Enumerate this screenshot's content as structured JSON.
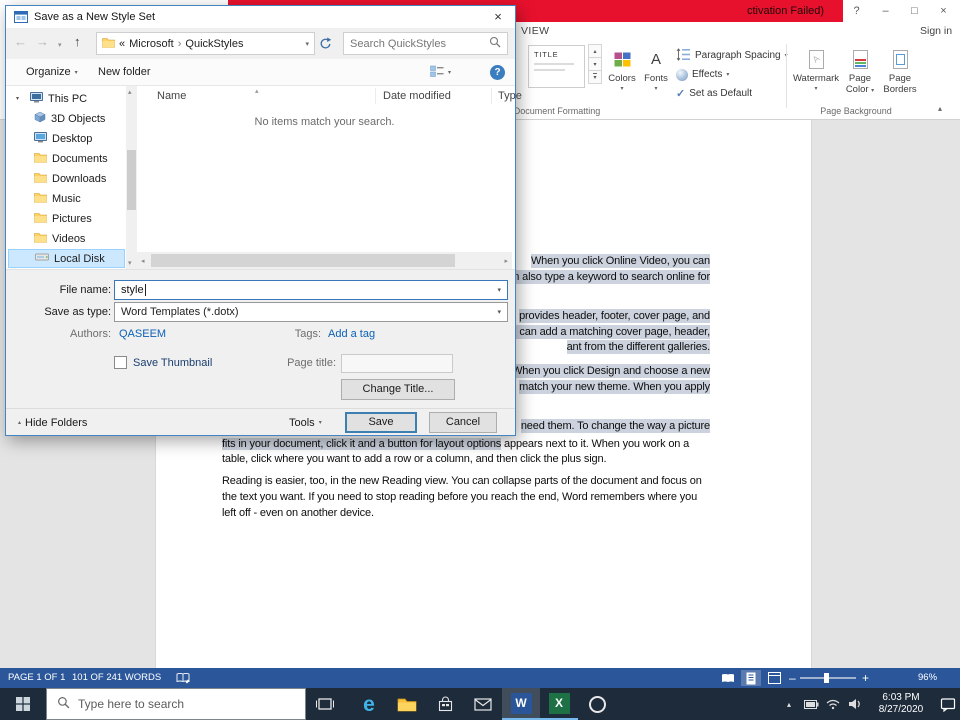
{
  "window": {
    "title_fragment": "ctivation Failed)",
    "active_tab": "VIEW",
    "sign_in": "Sign in",
    "controls": {
      "help": "?",
      "minimize": "–",
      "maximize": "□",
      "close": "×"
    }
  },
  "ribbon": {
    "style_gallery_item": "TITLE",
    "colors_label": "Colors",
    "fonts_label": "Fonts",
    "paragraph_spacing_label": "Paragraph Spacing",
    "effects_label": "Effects",
    "set_as_default_label": "Set as Default",
    "watermark_label": "Watermark",
    "page_color_label": "Page Color",
    "page_borders_label": "Page Borders",
    "group_document_formatting": "Document Formatting",
    "group_page_background": "Page Background"
  },
  "document": {
    "selection_fragments": [
      "When you click Online Video, you can",
      "an also type a keyword to search online for",
      "provides header, footer, cover page, and",
      "ou can add a matching cover page, header,",
      "ant from the different galleries.",
      "d. When you click Design and choose a new",
      "match your new theme. When you apply",
      "need them. To change the way a picture"
    ],
    "partial_line": {
      "selected": "fits in your document, click it and a button for layout options",
      "rest": " appears next to it. When you work on a"
    },
    "lines": [
      "table, click where you want to add a row or a column, and then click the plus sign.",
      "Reading is easier, too, in the new Reading view. You can collapse parts of the document and focus on",
      "the text you want. If you need to stop reading before you reach the end, Word remembers where you",
      "left off - even on another device."
    ]
  },
  "status_bar": {
    "page_info": "PAGE 1 OF 1",
    "word_count": "101 OF 241 WORDS",
    "zoom_level": "96%"
  },
  "dialog": {
    "title": "Save as a New Style Set",
    "nav": {
      "breadcrumb_overflow": "«",
      "crumb_parent": "Microsoft",
      "breadcrumb_separator": "›",
      "crumb_current": "QuickStyles",
      "search_placeholder": "Search QuickStyles"
    },
    "toolbar": {
      "organize_label": "Organize",
      "new_folder_label": "New folder"
    },
    "sidebar_items": [
      "This PC",
      "3D Objects",
      "Desktop",
      "Documents",
      "Downloads",
      "Music",
      "Pictures",
      "Videos",
      "Local Disk"
    ],
    "file_list": {
      "columns": [
        "Name",
        "Date modified",
        "Type"
      ],
      "empty_message": "No items match your search."
    },
    "fields": {
      "file_name_label": "File name:",
      "file_name_value": "style",
      "save_as_type_label": "Save as type:",
      "save_as_type_value": "Word Templates (*.dotx)",
      "authors_label": "Authors:",
      "authors_value": "QASEEM",
      "tags_label": "Tags:",
      "tags_placeholder": "Add a tag",
      "save_thumbnail_label": "Save Thumbnail",
      "page_title_label": "Page title:",
      "change_title_label": "Change Title..."
    },
    "footer": {
      "hide_folders_label": "Hide Folders",
      "tools_label": "Tools",
      "save_label": "Save",
      "cancel_label": "Cancel"
    }
  },
  "taskbar": {
    "search_placeholder": "Type here to search",
    "clock_time": "6:03 PM",
    "clock_date": "8/27/2020"
  },
  "colors": {
    "accent_blue": "#0078d7",
    "word_status_bar": "#2b579a",
    "activation_banner_red": "#e8112d",
    "selection_highlight": "#ccd3de",
    "taskbar_bg": "#1d2b3b"
  }
}
